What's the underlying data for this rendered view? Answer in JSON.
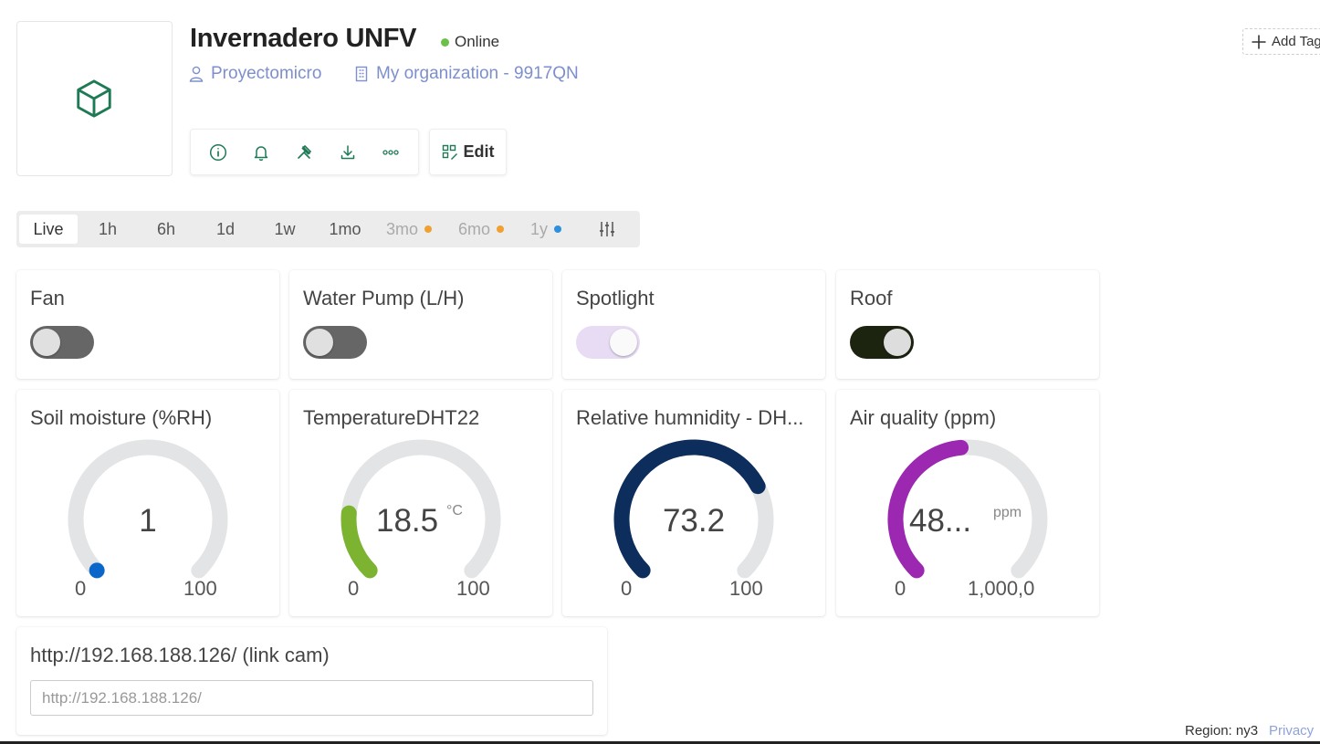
{
  "header": {
    "title": "Invernadero UNFV",
    "status": "Online",
    "status_color": "#6cc04a",
    "owner": "Proyectomicro",
    "organization": "My organization - 9917QN",
    "add_tag": "Add Tag",
    "edit_label": "Edit",
    "logo_icon": "cube-icon",
    "toolbar_icons": [
      "info-icon",
      "bell-icon",
      "tools-icon",
      "download-icon",
      "more-icon"
    ]
  },
  "time_range": {
    "items": [
      "Live",
      "1h",
      "6h",
      "1d",
      "1w",
      "1mo",
      "3mo",
      "6mo",
      "1y"
    ],
    "active": "Live",
    "dot_colors": {
      "3mo": "#f0a030",
      "6mo": "#f0a030",
      "1y": "#2d8fdd"
    }
  },
  "switches": [
    {
      "title": "Fan",
      "state": "off"
    },
    {
      "title": "Water Pump (L/H)",
      "state": "off"
    },
    {
      "title": "Spotlight",
      "state": "on"
    },
    {
      "title": "Roof",
      "state": "on"
    }
  ],
  "gauges": [
    {
      "title": "Soil moisture (%RH)",
      "value": "1",
      "unit": "",
      "min": "0",
      "max": "100",
      "fraction": 0.01,
      "color": "#0a66c8"
    },
    {
      "title": "TemperatureDHT22",
      "value": "18.5",
      "unit": "°C",
      "min": "0",
      "max": "100",
      "fraction": 0.185,
      "color": "#7cb330"
    },
    {
      "title": "Relative humnidity - DH...",
      "value": "73.2",
      "unit": "",
      "min": "0",
      "max": "100",
      "fraction": 0.732,
      "color": "#0d2d5c"
    },
    {
      "title": "Air quality (ppm)",
      "value": "48...",
      "unit": "ppm",
      "min": "0",
      "max": "1,000,0",
      "fraction": 0.48,
      "color": "#9c27b0"
    }
  ],
  "link_widget": {
    "title": "http://192.168.188.126/ (link cam)",
    "value": "http://192.168.188.126/"
  },
  "footer": {
    "region": "Region: ny3",
    "privacy": "Privacy"
  }
}
